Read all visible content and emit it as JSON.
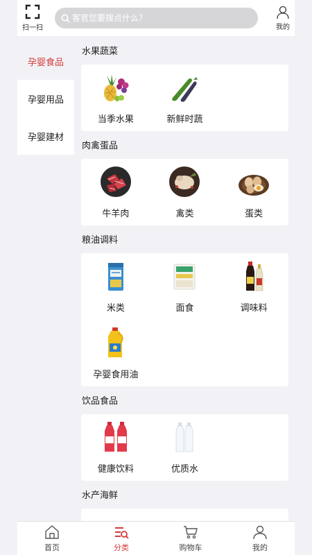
{
  "header": {
    "scan_label": "扫一扫",
    "search_placeholder": "客官您要搜点什么？",
    "mine_label": "我的"
  },
  "sidebar": {
    "items": [
      {
        "label": "孕婴食品",
        "active": true
      },
      {
        "label": "孕婴用品",
        "active": false
      },
      {
        "label": "孕婴建材",
        "active": false
      }
    ]
  },
  "sections": [
    {
      "title": "水果蔬菜",
      "items": [
        {
          "label": "当季水果",
          "icon": "fruit-icon"
        },
        {
          "label": "新鲜时蔬",
          "icon": "vegetable-icon"
        }
      ]
    },
    {
      "title": "肉禽蛋品",
      "items": [
        {
          "label": "牛羊肉",
          "icon": "beef-icon"
        },
        {
          "label": "禽类",
          "icon": "poultry-icon"
        },
        {
          "label": "蛋类",
          "icon": "egg-icon"
        }
      ]
    },
    {
      "title": "粮油调料",
      "items": [
        {
          "label": "米类",
          "icon": "rice-bag-icon"
        },
        {
          "label": "面食",
          "icon": "flour-bag-icon"
        },
        {
          "label": "调味料",
          "icon": "sauce-bottle-icon"
        },
        {
          "label": "孕婴食用油",
          "icon": "oil-bottle-icon"
        }
      ]
    },
    {
      "title": "饮品食品",
      "items": [
        {
          "label": "健康饮料",
          "icon": "soda-bottle-icon"
        },
        {
          "label": "优质水",
          "icon": "water-bottle-icon"
        }
      ]
    },
    {
      "title": "水产海鲜",
      "items": [
        {
          "label": "",
          "icon": "seafood-icon"
        },
        {
          "label": "",
          "icon": "seafood-icon"
        },
        {
          "label": "",
          "icon": "seafood-icon"
        }
      ]
    }
  ],
  "bottom_nav": {
    "items": [
      {
        "label": "首页",
        "icon": "home-icon",
        "active": false
      },
      {
        "label": "分类",
        "icon": "category-icon",
        "active": true
      },
      {
        "label": "购物车",
        "icon": "cart-icon",
        "active": false
      },
      {
        "label": "我的",
        "icon": "user-icon",
        "active": false
      }
    ]
  },
  "colors": {
    "accent": "#d53a3a",
    "page_bg": "#f2f2f6",
    "search_bg": "#d6d6d8"
  }
}
